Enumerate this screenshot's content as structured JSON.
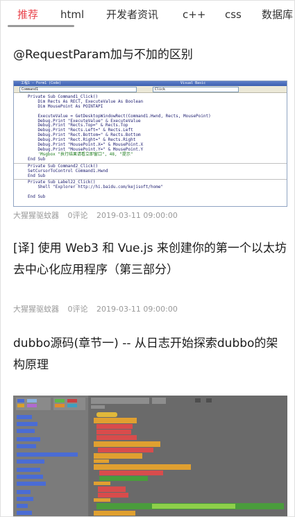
{
  "tabs": [
    {
      "label": "推荐",
      "active": true
    },
    {
      "label": "html",
      "active": false
    },
    {
      "label": "开发者资讯",
      "active": false
    },
    {
      "label": "c++",
      "active": false
    },
    {
      "label": "css",
      "active": false
    },
    {
      "label": "数据库",
      "active": false
    }
  ],
  "articles": [
    {
      "title": "@RequestParam加与不加的区别",
      "author": "大猩猩驱蚊器",
      "comments": "0评论",
      "date": "2019-03-11 09:00:00",
      "thumbnail": {
        "window_title": "工程1 - Form1 (Code)",
        "window_title_mid": "Visual Basic",
        "left_combo": "Command1",
        "right_combo": "Click",
        "code_lines": [
          "Private Sub Command1_Click()",
          "    Dim Rects As RECT, ExecuteValue As Boolean",
          "    Dim MousePoint As POINTAPI",
          "",
          "    ExecuteValue = GetDesktopWindowRect(Command1.Hwnd, Rects, MousePoint)",
          "    Debug.Print \"ExecuteValue\" & ExecuteValue",
          "    Debug.Print \"Rects.Top=\" & Rects.Top",
          "    Debug.Print \"Rects.Left=\" & Rects.Left",
          "    Debug.Print \"Rect.Bottom=\" & Rects.Bottom",
          "    Debug.Print \"Rect.Right=\" & Rects.Right",
          "    Debug.Print \"MousePoint.X=\" & MousePoint.X",
          "    Debug.Print \"MousePoint.Y=\" & MousePoint.Y",
          "    'Msgbox \"执行结果请看立即窗口\", 48, \"提示\"",
          "End Sub",
          "---",
          "Private Sub Command2_Click()",
          "SetCursorToControl Command1.Hwnd",
          "End Sub",
          "---",
          "Private Sub Label22_Click()",
          "    Shell \"Explorer http://hi.baidu.com/kejisoft/home\"",
          "",
          "End Sub"
        ]
      }
    },
    {
      "title": "[译] 使用 Web3 和 Vue.js 来创建你的第一个以太坊去中心化应用程序（第三部分）",
      "author": "大猩猩驱蚊器",
      "comments": "0评论",
      "date": "2019-03-11 09:00:00"
    },
    {
      "title": "dubbo源码(章节一) -- 从日志开始探索dubbo的架构原理",
      "thumbnail_kind": "scratch-blocks-editor"
    }
  ],
  "colors": {
    "active_tab": "#e8424a",
    "meta_text": "#999999",
    "title_text": "#1c1c1c"
  }
}
